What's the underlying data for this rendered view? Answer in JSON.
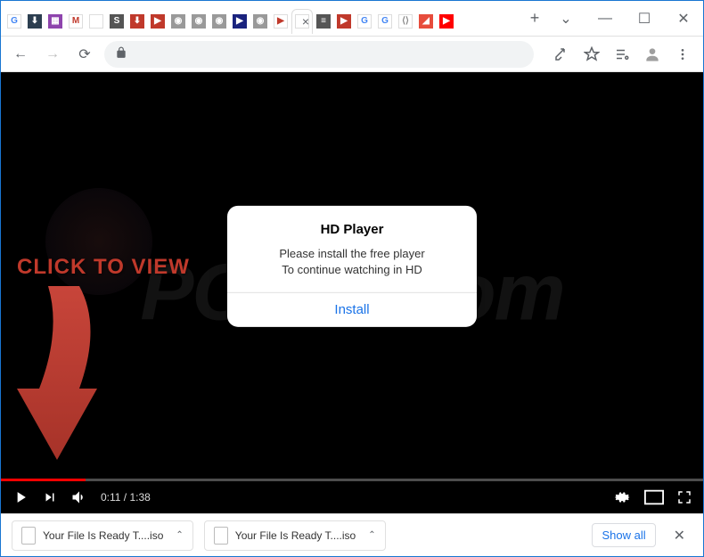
{
  "tabs": [
    {
      "icon": "G",
      "bg": "#fff",
      "color": "#4285f4"
    },
    {
      "icon": "⬇",
      "bg": "#2c3e50",
      "color": "#fff"
    },
    {
      "icon": "▦",
      "bg": "#8e44ad",
      "color": "#fff"
    },
    {
      "icon": "M",
      "bg": "#fff",
      "color": "#c0392b"
    },
    {
      "icon": "",
      "bg": "#fff",
      "color": "#fff"
    },
    {
      "icon": "S",
      "bg": "#555",
      "color": "#fff"
    },
    {
      "icon": "⬇",
      "bg": "#c0392b",
      "color": "#fff"
    },
    {
      "icon": "▶",
      "bg": "#c0392b",
      "color": "#fff"
    },
    {
      "icon": "◉",
      "bg": "#999",
      "color": "#fff"
    },
    {
      "icon": "◉",
      "bg": "#999",
      "color": "#fff"
    },
    {
      "icon": "◉",
      "bg": "#999",
      "color": "#fff"
    },
    {
      "icon": "▶",
      "bg": "#1a237e",
      "color": "#fff"
    },
    {
      "icon": "◉",
      "bg": "#999",
      "color": "#fff"
    },
    {
      "icon": "▶",
      "bg": "#fff",
      "color": "#c0392b"
    },
    {
      "icon": "",
      "bg": "#fff",
      "color": "#fff",
      "active": true
    },
    {
      "icon": "≡",
      "bg": "#555",
      "color": "#fff"
    },
    {
      "icon": "▶",
      "bg": "#c0392b",
      "color": "#fff"
    },
    {
      "icon": "G",
      "bg": "#fff",
      "color": "#4285f4"
    },
    {
      "icon": "G",
      "bg": "#fff",
      "color": "#4285f4"
    },
    {
      "icon": "⟨⟩",
      "bg": "#fff",
      "color": "#888"
    },
    {
      "icon": "◢",
      "bg": "#e74c3c",
      "color": "#fff"
    },
    {
      "icon": "▶",
      "bg": "#ff0000",
      "color": "#fff"
    }
  ],
  "newtab_label": "+",
  "window_controls": {
    "dropdown": "⌄",
    "minimize": "—",
    "maximize": "☐",
    "close": "✕"
  },
  "toolbar": {
    "back": "←",
    "forward": "→",
    "reload": "⟳",
    "lock": "🔒",
    "share": "⇪",
    "star": "☆",
    "list": "≡",
    "profile": "👤",
    "menu": "⋮"
  },
  "overlay": {
    "click_to_view": "CLICK TO VIEW"
  },
  "watermark": "PCrisk.com",
  "popup": {
    "title": "HD Player",
    "line1": "Please install the free player",
    "line2": "To continue watching in HD",
    "button": "Install"
  },
  "video": {
    "current_time": "0:11",
    "total_time": "1:38",
    "separator": " / ",
    "progress_percent": 12
  },
  "downloads": {
    "items": [
      {
        "name": "Your File Is Ready T....iso"
      },
      {
        "name": "Your File Is Ready T....iso"
      }
    ],
    "show_all": "Show all",
    "close": "✕"
  }
}
